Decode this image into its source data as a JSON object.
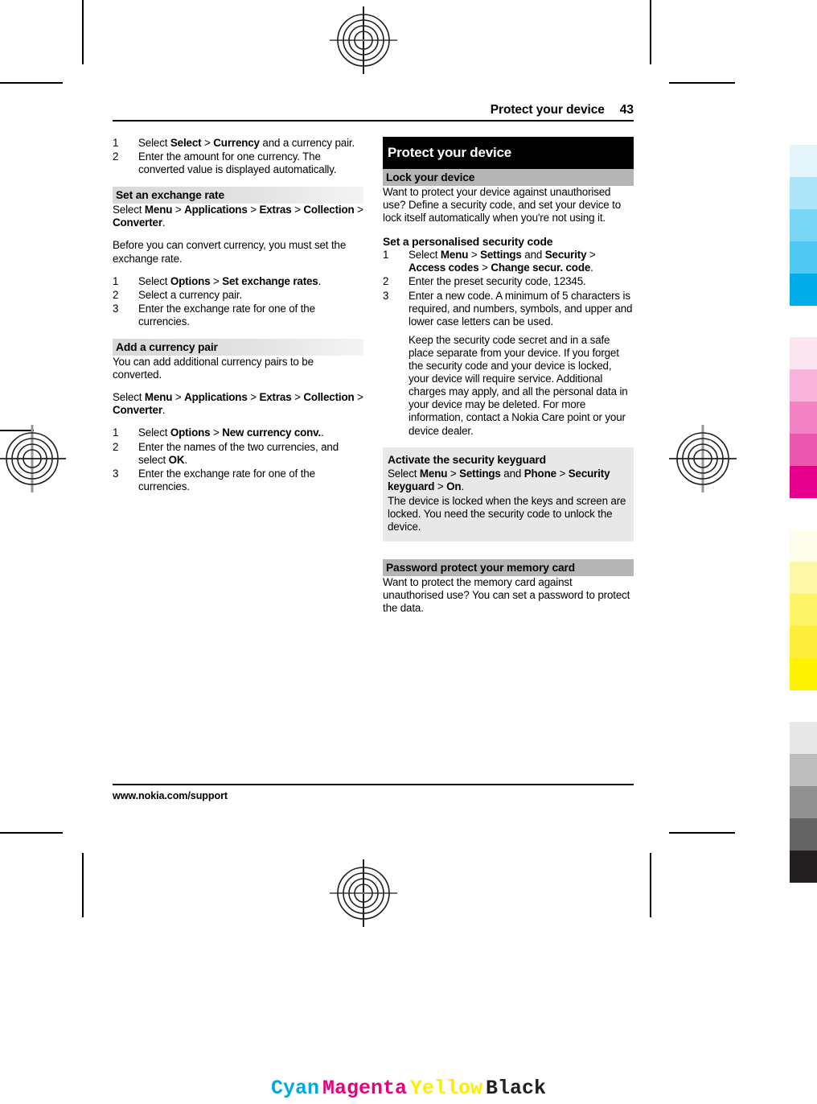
{
  "header": {
    "title": "Protect your device",
    "page_number": "43"
  },
  "footer": {
    "url": "www.nokia.com/support"
  },
  "left_column": {
    "steps_top": [
      {
        "num": "1",
        "text_parts": [
          {
            "t": "Select ",
            "b": false
          },
          {
            "t": "Select",
            "b": true
          },
          {
            "t": "  > ",
            "b": false
          },
          {
            "t": "Currency",
            "b": true
          },
          {
            "t": " and a currency pair.",
            "b": false
          }
        ]
      },
      {
        "num": "2",
        "text_parts": [
          {
            "t": "Enter the amount for one currency. The converted value is displayed automatically.",
            "b": false
          }
        ]
      }
    ],
    "section_exchange_rate": {
      "heading": "Set an exchange rate",
      "path_parts": [
        {
          "t": "Select ",
          "b": false
        },
        {
          "t": "Menu",
          "b": true
        },
        {
          "t": "  > ",
          "b": false
        },
        {
          "t": "Applications",
          "b": true
        },
        {
          "t": "  > ",
          "b": false
        },
        {
          "t": "Extras",
          "b": true
        },
        {
          "t": "  > ",
          "b": false
        },
        {
          "t": "Collection",
          "b": true
        },
        {
          "t": "  > ",
          "b": false
        },
        {
          "t": "Converter",
          "b": true
        },
        {
          "t": ".",
          "b": false
        }
      ],
      "intro": "Before you can convert currency, you must set the exchange rate.",
      "steps": [
        {
          "num": "1",
          "text_parts": [
            {
              "t": "Select ",
              "b": false
            },
            {
              "t": "Options",
              "b": true
            },
            {
              "t": "  > ",
              "b": false
            },
            {
              "t": "Set exchange rates",
              "b": true
            },
            {
              "t": ".",
              "b": false
            }
          ]
        },
        {
          "num": "2",
          "text_parts": [
            {
              "t": "Select a currency pair.",
              "b": false
            }
          ]
        },
        {
          "num": "3",
          "text_parts": [
            {
              "t": "Enter the exchange rate for one of the currencies.",
              "b": false
            }
          ]
        }
      ]
    },
    "section_currency_pair": {
      "heading": "Add a currency pair",
      "intro": "You can add additional currency pairs to be converted.",
      "path_parts": [
        {
          "t": "Select ",
          "b": false
        },
        {
          "t": "Menu",
          "b": true
        },
        {
          "t": "  > ",
          "b": false
        },
        {
          "t": "Applications",
          "b": true
        },
        {
          "t": "  > ",
          "b": false
        },
        {
          "t": "Extras",
          "b": true
        },
        {
          "t": "  > ",
          "b": false
        },
        {
          "t": "Collection",
          "b": true
        },
        {
          "t": "  > ",
          "b": false
        },
        {
          "t": "Converter",
          "b": true
        },
        {
          "t": ".",
          "b": false
        }
      ],
      "steps": [
        {
          "num": "1",
          "text_parts": [
            {
              "t": "Select ",
              "b": false
            },
            {
              "t": "Options",
              "b": true
            },
            {
              "t": "  > ",
              "b": false
            },
            {
              "t": "New currency conv.",
              "b": true
            },
            {
              "t": ".",
              "b": false
            }
          ]
        },
        {
          "num": "2",
          "text_parts": [
            {
              "t": "Enter the names of the two currencies, and select ",
              "b": false
            },
            {
              "t": "OK",
              "b": true
            },
            {
              "t": ".",
              "b": false
            }
          ]
        },
        {
          "num": "3",
          "text_parts": [
            {
              "t": "Enter the exchange rate for one of the currencies.",
              "b": false
            }
          ]
        }
      ]
    }
  },
  "right_column": {
    "chapter_title": "Protect your device",
    "section_lock": {
      "heading": "Lock your device",
      "intro": "Want to protect your device against unauthorised use? Define a security code, and set your device to lock itself automatically when you're not using it."
    },
    "section_security_code": {
      "heading": "Set a personalised security code",
      "steps": [
        {
          "num": "1",
          "text_parts": [
            {
              "t": "Select ",
              "b": false
            },
            {
              "t": "Menu",
              "b": true
            },
            {
              "t": "  > ",
              "b": false
            },
            {
              "t": "Settings",
              "b": true
            },
            {
              "t": " and ",
              "b": false
            },
            {
              "t": "Security",
              "b": true
            },
            {
              "t": "  > ",
              "b": false
            },
            {
              "t": "Access codes",
              "b": true
            },
            {
              "t": "  > ",
              "b": false
            },
            {
              "t": "Change secur. code",
              "b": true
            },
            {
              "t": ".",
              "b": false
            }
          ]
        },
        {
          "num": "2",
          "text_parts": [
            {
              "t": "Enter the preset security code, 12345.",
              "b": false
            }
          ]
        },
        {
          "num": "3",
          "text_parts": [
            {
              "t": "Enter a new code. A minimum of 5 characters is required, and numbers, symbols, and upper and lower case letters can be used.",
              "b": false
            }
          ]
        }
      ],
      "note": "Keep the security code secret and in a safe place separate from your device. If you forget the security code and your device is locked, your device will require service. Additional charges may apply, and all the personal data in your device may be deleted. For more information, contact a Nokia Care point or your device dealer."
    },
    "section_keyguard": {
      "heading": "Activate the security keyguard",
      "path_parts": [
        {
          "t": "Select ",
          "b": false
        },
        {
          "t": "Menu",
          "b": true
        },
        {
          "t": "  > ",
          "b": false
        },
        {
          "t": "Settings",
          "b": true
        },
        {
          "t": " and ",
          "b": false
        },
        {
          "t": "Phone",
          "b": true
        },
        {
          "t": "  > ",
          "b": false
        },
        {
          "t": "Security keyguard",
          "b": true
        },
        {
          "t": "  > ",
          "b": false
        },
        {
          "t": "On",
          "b": true
        },
        {
          "t": ".",
          "b": false
        }
      ],
      "body": "The device is locked when the keys and screen are locked. You need the security code to unlock the device."
    },
    "section_memory_card": {
      "heading": "Password protect your memory card",
      "body": "Want to protect the memory card against unauthorised use? You can set a password to protect the data."
    }
  },
  "cmyk_bar": {
    "labels": [
      "Cyan",
      "Magenta",
      "Yellow",
      "Black"
    ],
    "colors": [
      "#00a7e1",
      "#e6007e",
      "#ffed00",
      "#231f20"
    ]
  },
  "color_strip": {
    "groups": [
      {
        "name": "cyan",
        "swatches": [
          "#e4f5fc",
          "#ace6f8",
          "#7ad6f5",
          "#4fc9f2",
          "#00ade8"
        ]
      },
      {
        "name": "magenta",
        "swatches": [
          "#fae5f1",
          "#f7b3da",
          "#f282c4",
          "#ed57b0",
          "#e6008c"
        ]
      },
      {
        "name": "yellow",
        "swatches": [
          "#fffdec",
          "#fdf7a8",
          "#fdf468",
          "#fdee3c",
          "#fff200"
        ]
      },
      {
        "name": "black",
        "swatches": [
          "#e8e8e8",
          "#bdbdbd",
          "#919191",
          "#646464",
          "#231f20"
        ]
      }
    ]
  }
}
